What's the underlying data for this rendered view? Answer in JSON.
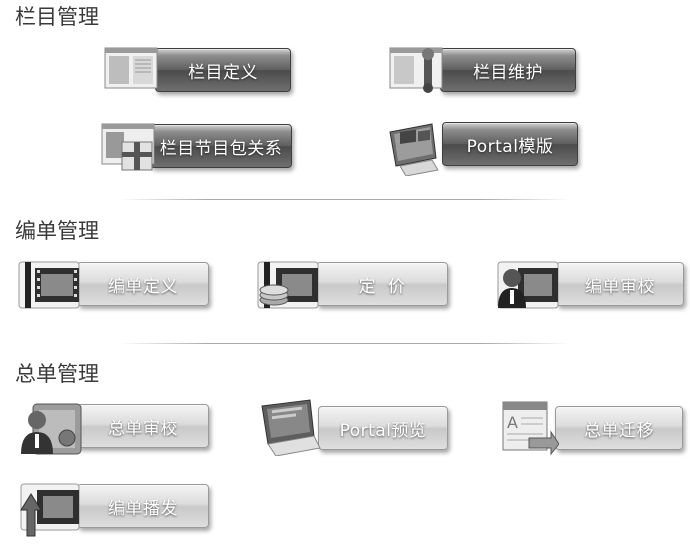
{
  "sections": [
    {
      "title": "栏目管理",
      "tiles": [
        {
          "label": "栏目定义",
          "icon": "book-pages-icon"
        },
        {
          "label": "栏目维护",
          "icon": "book-wrench-icon"
        },
        {
          "label": "栏目节目包关系",
          "icon": "book-gift-icon"
        },
        {
          "label": "Portal模版",
          "icon": "monitor-windows-icon"
        }
      ]
    },
    {
      "title": "编单管理",
      "tiles": [
        {
          "label": "编单定义",
          "icon": "film-folder-icon"
        },
        {
          "label": "定  价",
          "icon": "film-coins-icon"
        },
        {
          "label": "编单审校",
          "icon": "film-user-icon"
        }
      ]
    },
    {
      "title": "总单管理",
      "tiles": [
        {
          "label": "总单审校",
          "icon": "user-card-icon"
        },
        {
          "label": "Portal预览",
          "icon": "monitor-preview-icon"
        },
        {
          "label": "总单迁移",
          "icon": "document-migrate-icon"
        },
        {
          "label": "编单播发",
          "icon": "film-upload-icon"
        }
      ]
    }
  ]
}
